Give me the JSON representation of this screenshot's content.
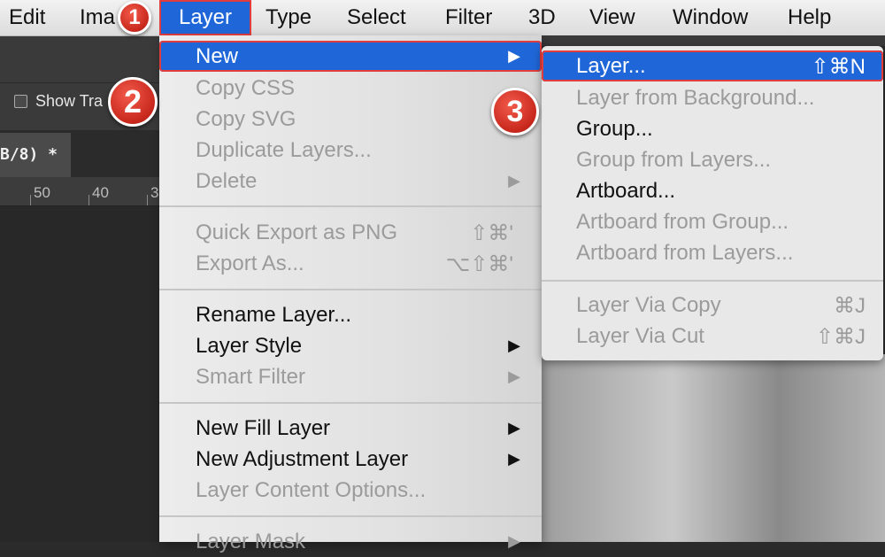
{
  "menubar": {
    "items": [
      "Edit",
      "Ima",
      "Layer",
      "Type",
      "Select",
      "Filter",
      "3D",
      "View",
      "Window",
      "Help"
    ]
  },
  "options": {
    "checkbox_label": "Show Tra"
  },
  "document": {
    "tab_title": "B/8) *"
  },
  "ruler": {
    "labels": [
      "50",
      "40",
      "3"
    ]
  },
  "layer_menu": {
    "items": [
      {
        "label": "New",
        "shortcut": "",
        "submenu": true,
        "state": "selected"
      },
      {
        "label": "Copy CSS",
        "shortcut": "",
        "submenu": false,
        "state": "disabled"
      },
      {
        "label": "Copy SVG",
        "shortcut": "",
        "submenu": false,
        "state": "disabled"
      },
      {
        "label": "Duplicate Layers...",
        "shortcut": "",
        "submenu": false,
        "state": "disabled"
      },
      {
        "label": "Delete",
        "shortcut": "",
        "submenu": true,
        "state": "disabled"
      },
      {
        "label": "Quick Export as PNG",
        "shortcut": "⇧⌘'",
        "submenu": false,
        "state": "disabled"
      },
      {
        "label": "Export As...",
        "shortcut": "⌥⇧⌘'",
        "submenu": false,
        "state": "disabled"
      },
      {
        "label": "Rename Layer...",
        "shortcut": "",
        "submenu": false,
        "state": "enabled"
      },
      {
        "label": "Layer Style",
        "shortcut": "",
        "submenu": true,
        "state": "enabled"
      },
      {
        "label": "Smart Filter",
        "shortcut": "",
        "submenu": true,
        "state": "disabled"
      },
      {
        "label": "New Fill Layer",
        "shortcut": "",
        "submenu": true,
        "state": "enabled"
      },
      {
        "label": "New Adjustment Layer",
        "shortcut": "",
        "submenu": true,
        "state": "enabled"
      },
      {
        "label": "Layer Content Options...",
        "shortcut": "",
        "submenu": false,
        "state": "disabled"
      },
      {
        "label": "Layer Mask",
        "shortcut": "",
        "submenu": true,
        "state": "disabled"
      }
    ]
  },
  "new_submenu": {
    "items": [
      {
        "label": "Layer...",
        "shortcut": "⇧⌘N",
        "state": "selected"
      },
      {
        "label": "Layer from Background...",
        "shortcut": "",
        "state": "disabled"
      },
      {
        "label": "Group...",
        "shortcut": "",
        "state": "enabled"
      },
      {
        "label": "Group from Layers...",
        "shortcut": "",
        "state": "disabled"
      },
      {
        "label": "Artboard...",
        "shortcut": "",
        "state": "enabled"
      },
      {
        "label": "Artboard from Group...",
        "shortcut": "",
        "state": "disabled"
      },
      {
        "label": "Artboard from Layers...",
        "shortcut": "",
        "state": "disabled"
      },
      {
        "label": "Layer Via Copy",
        "shortcut": "⌘J",
        "state": "disabled"
      },
      {
        "label": "Layer Via Cut",
        "shortcut": "⇧⌘J",
        "state": "disabled"
      }
    ]
  },
  "badges": [
    "1",
    "2",
    "3"
  ],
  "colors": {
    "selection": "#1f66d8",
    "highlight_outline": "#e23d3d",
    "badge": "#d93a2b"
  }
}
